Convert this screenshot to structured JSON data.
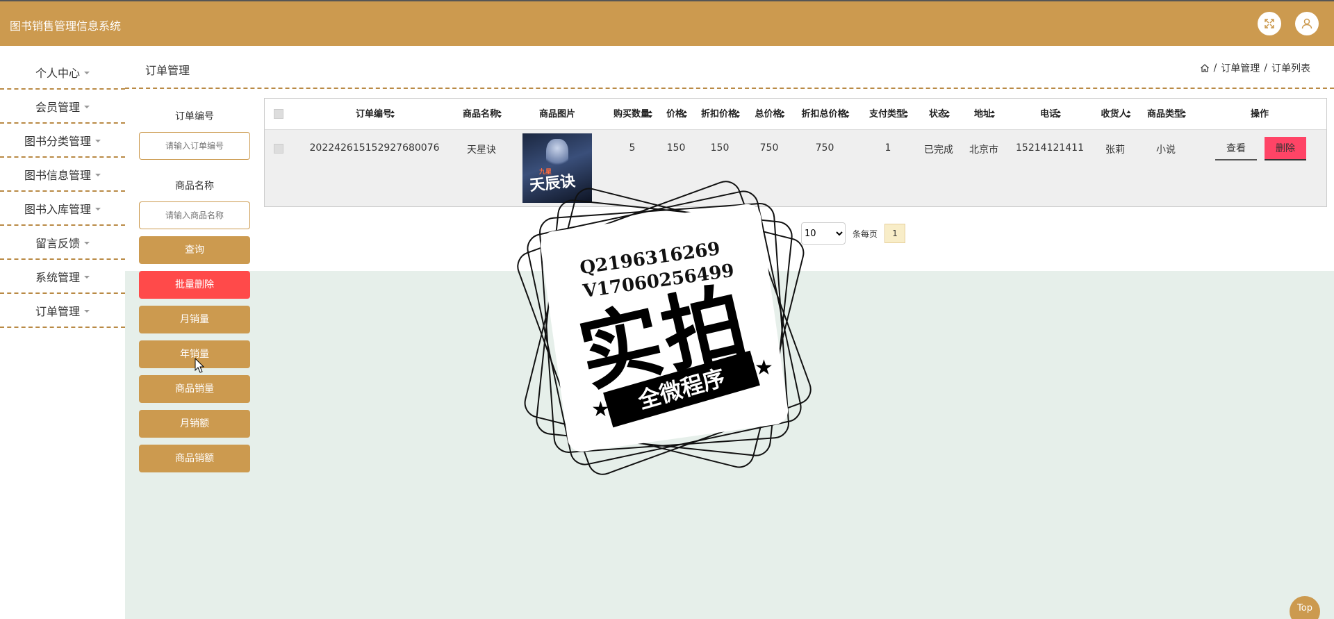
{
  "header": {
    "title": "图书销售管理信息系统",
    "fullscreen_icon": "fullscreen-icon",
    "user_icon": "user-icon"
  },
  "sidebar": {
    "items": [
      {
        "label": "个人中心"
      },
      {
        "label": "会员管理"
      },
      {
        "label": "图书分类管理"
      },
      {
        "label": "图书信息管理"
      },
      {
        "label": "图书入库管理"
      },
      {
        "label": "留言反馈"
      },
      {
        "label": "系统管理"
      },
      {
        "label": "订单管理"
      }
    ]
  },
  "page": {
    "title": "订单管理",
    "breadcrumb": [
      "订单管理",
      "订单列表"
    ]
  },
  "filter": {
    "order_no_label": "订单编号",
    "order_no_placeholder": "请输入订单编号",
    "product_label": "商品名称",
    "product_placeholder": "请输入商品名称",
    "buttons": [
      "查询",
      "批量删除",
      "月销量",
      "年销量",
      "商品销量",
      "月销额",
      "商品销额"
    ]
  },
  "table": {
    "headers": [
      "订单编号",
      "商品名称",
      "商品图片",
      "购买数量",
      "价格",
      "折扣价格",
      "总价格",
      "折扣总价格",
      "支付类型",
      "状态",
      "地址",
      "电话",
      "收货人",
      "商品类型",
      "操作"
    ],
    "rows": [
      {
        "order_no": "202242615152927680076",
        "product": "天星诀",
        "cover_title": "天辰诀",
        "cover_sub": "九星",
        "quantity": "5",
        "price": "150",
        "discount_price": "150",
        "total": "750",
        "discount_total": "750",
        "pay_type": "1",
        "status": "已完成",
        "address": "北京市",
        "phone": "15214121411",
        "receiver": "张莉",
        "category": "小说",
        "view_label": "查看",
        "delete_label": "删除"
      }
    ]
  },
  "pagination": {
    "page_size": "10",
    "page_size_options": [
      "10"
    ],
    "per_page_label": "条每页",
    "current_page": "1"
  },
  "watermark": {
    "line1": "Q2196316269",
    "line2": "V17060256499",
    "big": "实拍",
    "ribbon": "全微程序"
  },
  "top_button": "Top"
}
